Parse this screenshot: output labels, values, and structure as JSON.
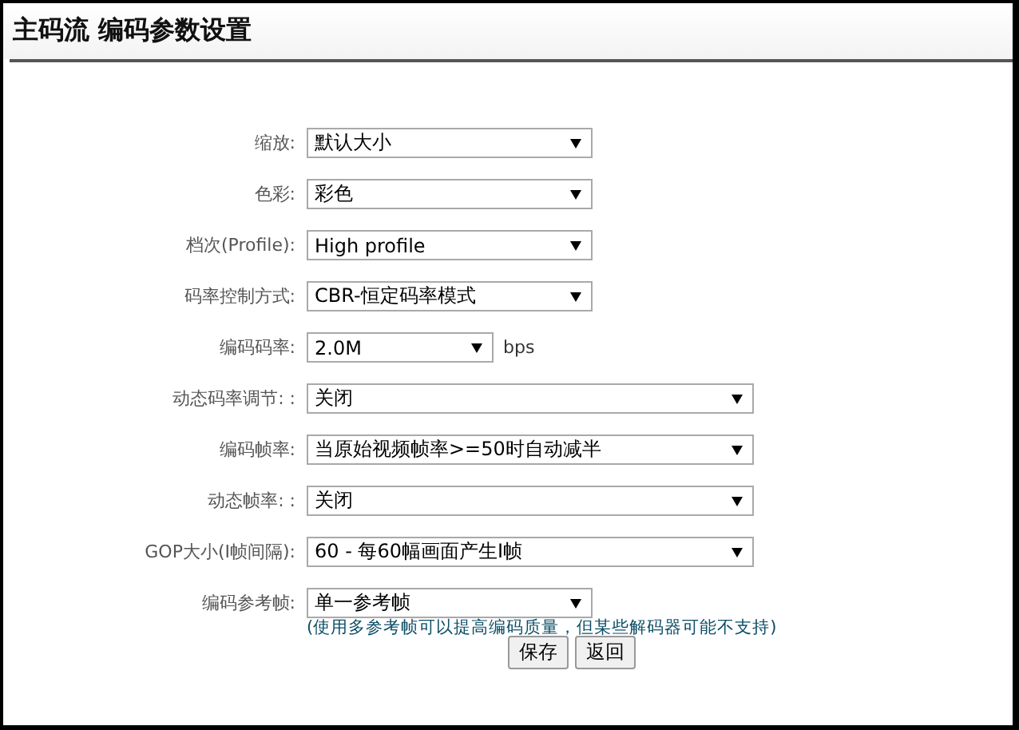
{
  "title": "主码流 编码参数设置",
  "fields": [
    {
      "label": "缩放:",
      "value": "默认大小",
      "kind": "medium"
    },
    {
      "label": "色彩:",
      "value": "彩色",
      "kind": "medium"
    },
    {
      "label": "档次(Profile):",
      "value": "High profile",
      "kind": "medium"
    },
    {
      "label": "码率控制方式:",
      "value": "CBR-恒定码率模式",
      "kind": "medium"
    },
    {
      "label": "编码码率:",
      "value": "2.0M",
      "kind": "small",
      "unit": "bps"
    },
    {
      "label": "动态码率调节: :",
      "value": "关闭",
      "kind": "large"
    },
    {
      "label": "编码帧率:",
      "value": "当原始视频帧率>=50时自动减半",
      "kind": "large"
    },
    {
      "label": "动态帧率: :",
      "value": "关闭",
      "kind": "large"
    },
    {
      "label": "GOP大小(I帧间隔):",
      "value": "60 - 每60幅画面产生I帧",
      "kind": "large"
    },
    {
      "label": "编码参考帧:",
      "value": "单一参考帧",
      "kind": "medium",
      "note": "(使用多参考帧可以提高编码质量，但某些解码器可能不支持)"
    }
  ],
  "buttons": [
    "保存",
    "返回"
  ]
}
